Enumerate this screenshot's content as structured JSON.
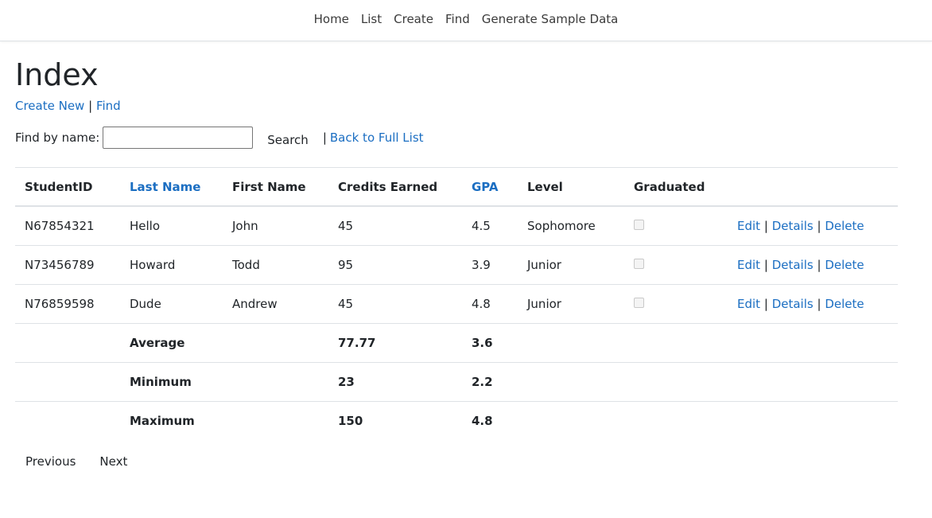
{
  "nav": {
    "items": [
      "Home",
      "List",
      "Create",
      "Find",
      "Generate Sample Data"
    ]
  },
  "page": {
    "title": "Index",
    "create_new": "Create New",
    "separator": "|",
    "find": "Find"
  },
  "search": {
    "label": "Find by name:",
    "value": "",
    "button": "Search",
    "separator": "|",
    "back_link": "Back to Full List"
  },
  "table": {
    "headers": [
      "StudentID",
      "Last Name",
      "First Name",
      "Credits Earned",
      "GPA",
      "Level",
      "Graduated"
    ],
    "rows": [
      {
        "id": "N67854321",
        "last": "Hello",
        "first": "John",
        "credits": "45",
        "gpa": "4.5",
        "level": "Sophomore",
        "graduated": false
      },
      {
        "id": "N73456789",
        "last": "Howard",
        "first": "Todd",
        "credits": "95",
        "gpa": "3.9",
        "level": "Junior",
        "graduated": false
      },
      {
        "id": "N76859598",
        "last": "Dude",
        "first": "Andrew",
        "credits": "45",
        "gpa": "4.8",
        "level": "Junior",
        "graduated": false
      }
    ],
    "row_actions": {
      "edit": "Edit",
      "details": "Details",
      "delete": "Delete",
      "separator": "|"
    },
    "summary": [
      {
        "label": "Average",
        "credits": "77.77",
        "gpa": "3.6"
      },
      {
        "label": "Minimum",
        "credits": "23",
        "gpa": "2.2"
      },
      {
        "label": "Maximum",
        "credits": "150",
        "gpa": "4.8"
      }
    ]
  },
  "pager": {
    "previous": "Previous",
    "next": "Next"
  },
  "colors": {
    "link": "#1b6ec2",
    "border": "#dee2e6",
    "text": "#212529"
  }
}
